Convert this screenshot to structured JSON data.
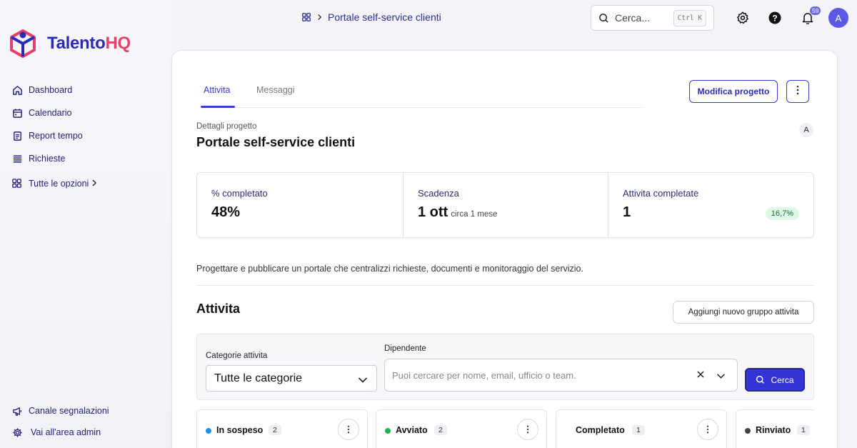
{
  "brand": {
    "name_part1": "Talento",
    "name_part2": "HQ",
    "primary": "#2b2bb5",
    "accent": "#ea3f6a"
  },
  "breadcrumb": {
    "icon": "apps-grid-icon",
    "title": "Portale self-service clienti"
  },
  "search": {
    "placeholder": "Cerca...",
    "shortcut": "Ctrl K"
  },
  "notifications": {
    "count": "59"
  },
  "user": {
    "initial": "A"
  },
  "sidebar": {
    "items": [
      {
        "label": "Dashboard",
        "icon": "home-icon"
      },
      {
        "label": "Calendario",
        "icon": "calendar-icon"
      },
      {
        "label": "Report tempo",
        "icon": "report-icon"
      },
      {
        "label": "Richieste",
        "icon": "list-icon"
      }
    ],
    "more_label": "Tutte le opzioni",
    "bottom": [
      {
        "label": "Canale segnalazioni",
        "icon": "megaphone-icon"
      },
      {
        "label": "Vai all'area admin",
        "icon": "gear-icon"
      }
    ]
  },
  "tabs": [
    {
      "label": "Attivita",
      "active": true
    },
    {
      "label": "Messaggi",
      "active": false
    }
  ],
  "actions": {
    "edit_label": "Modifica progetto"
  },
  "project": {
    "subtitle": "Dettagli progetto",
    "title": "Portale self-service clienti",
    "owner_initial": "A",
    "description": "Progettare e pubblicare un portale che centralizzi richieste, documenti e monitoraggio del servizio."
  },
  "stats": {
    "completed_label": "% completato",
    "completed_value": "48%",
    "deadline_label": "Scadenza",
    "deadline_value": "1 ott",
    "deadline_sub": "circa 1 mese",
    "tasks_label": "Attivita completate",
    "tasks_value": "1",
    "tasks_pct": "16,7%"
  },
  "tasks": {
    "title": "Attivita",
    "add_group_label": "Aggiungi nuovo gruppo attivita",
    "filter": {
      "category_label": "Categorie attivita",
      "category_value": "Tutte le categorie",
      "employee_label": "Dipendente",
      "employee_placeholder": "Puoi cercare per nome, email, ufficio o team.",
      "search_label": "Cerca"
    },
    "columns": [
      {
        "name": "In sospeso",
        "count": "2",
        "color": "#1e90e8"
      },
      {
        "name": "Avviato",
        "count": "2",
        "color": "#22b14c"
      },
      {
        "name": "Completato",
        "count": "1",
        "color": "#ffffff"
      },
      {
        "name": "Rinviato",
        "count": "1",
        "color": "#444444"
      }
    ]
  }
}
